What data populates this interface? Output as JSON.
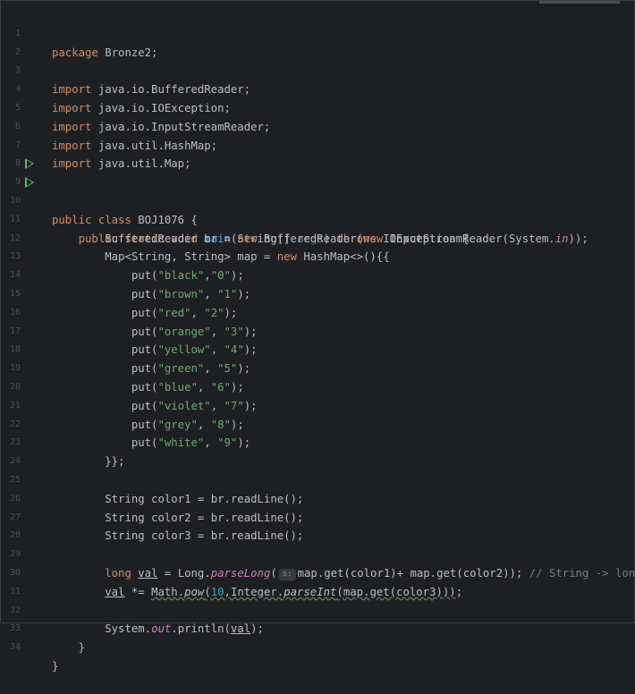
{
  "line_numbers": [
    "1",
    "2",
    "3",
    "4",
    "5",
    "6",
    "7",
    "8",
    "9",
    "10",
    "11",
    "12",
    "13",
    "14",
    "15",
    "16",
    "17",
    "18",
    "19",
    "20",
    "21",
    "22",
    "23",
    "24",
    "25",
    "26",
    "27",
    "28",
    "29",
    "30",
    "31",
    "32",
    "33",
    "34"
  ],
  "code": {
    "l1": {
      "kw": "package",
      "rest": " Bronze2;"
    },
    "l3": {
      "kw": "import",
      "rest": " java.io.BufferedReader;"
    },
    "l4": {
      "kw": "import",
      "rest": " java.io.IOException;"
    },
    "l5": {
      "kw": "import",
      "rest": " java.io.InputStreamReader;"
    },
    "l6": {
      "kw": "import",
      "rest": " java.util.HashMap;"
    },
    "l7": {
      "kw": "import",
      "rest": " java.util.Map;"
    },
    "l9": {
      "kw": "public class",
      "rest": " BOJ1076 {"
    },
    "l10": {
      "indent": "    ",
      "kw": "public static void",
      "sp": " ",
      "fn": "main",
      "a": "(String[] ",
      "param": "args",
      "b": ") ",
      "kw2": "throws",
      "c": " IOException {"
    },
    "l11": {
      "indent": "        ",
      "a": "BufferedReader br = ",
      "kw": "new",
      "b": " BufferedReader(",
      "kw2": "new",
      "c": " InputStreamReader(System.",
      "stat": "in",
      "d": "));"
    },
    "l12": {
      "indent": "        ",
      "a": "Map<String, String> map = ",
      "kw": "new",
      "b": " HashMap<>(){{"
    },
    "puts": [
      {
        "indent": "            ",
        "a": "put(",
        "s1": "\"black\"",
        "c": ",",
        "s2": "\"0\"",
        "e": ");"
      },
      {
        "indent": "            ",
        "a": "put(",
        "s1": "\"brown\"",
        "c": ", ",
        "s2": "\"1\"",
        "e": ");"
      },
      {
        "indent": "            ",
        "a": "put(",
        "s1": "\"red\"",
        "c": ", ",
        "s2": "\"2\"",
        "e": ");"
      },
      {
        "indent": "            ",
        "a": "put(",
        "s1": "\"orange\"",
        "c": ", ",
        "s2": "\"3\"",
        "e": ");"
      },
      {
        "indent": "            ",
        "a": "put(",
        "s1": "\"yellow\"",
        "c": ", ",
        "s2": "\"4\"",
        "e": ");"
      },
      {
        "indent": "            ",
        "a": "put(",
        "s1": "\"green\"",
        "c": ", ",
        "s2": "\"5\"",
        "e": ");"
      },
      {
        "indent": "            ",
        "a": "put(",
        "s1": "\"blue\"",
        "c": ", ",
        "s2": "\"6\"",
        "e": ");"
      },
      {
        "indent": "            ",
        "a": "put(",
        "s1": "\"violet\"",
        "c": ", ",
        "s2": "\"7\"",
        "e": ");"
      },
      {
        "indent": "            ",
        "a": "put(",
        "s1": "\"grey\"",
        "c": ", ",
        "s2": "\"8\"",
        "e": ");"
      },
      {
        "indent": "            ",
        "a": "put(",
        "s1": "\"white\"",
        "c": ", ",
        "s2": "\"9\"",
        "e": ");"
      }
    ],
    "l23": {
      "indent": "        ",
      "a": "}};"
    },
    "l25": {
      "indent": "        ",
      "a": "String color1 = br.readLine();"
    },
    "l26": {
      "indent": "        ",
      "a": "String color2 = br.readLine();"
    },
    "l27": {
      "indent": "        ",
      "a": "String color3 = br.readLine();"
    },
    "l29": {
      "indent": "        ",
      "kw": "long",
      "sp": " ",
      "ul": "val",
      "b": " = Long.",
      "stat": "parseLong",
      "c": "(",
      "hint": "s:",
      "d": "map.get(color1)+ map.get(color2)); ",
      "cm": "// String -> long"
    },
    "l30": {
      "indent": "        ",
      "ul": "val",
      "b": " *= ",
      "w1": "Math.",
      "w1i": "pow",
      "w2": "(",
      "n1": "10",
      "w3": ",Integer.",
      "w3i": "parseInt",
      "w4": "(map.get(color3)))",
      "e": ";"
    },
    "l32": {
      "indent": "        ",
      "a": "System.",
      "stat": "out",
      "b": ".println(",
      "ul": "val",
      "c": ");"
    },
    "l33": {
      "indent": "    ",
      "a": "}"
    },
    "l34": {
      "a": "}"
    }
  },
  "icons": {
    "run": "run-gutter-icon"
  },
  "colors": {
    "background": "#1e1f22",
    "keyword": "#cf8e6d",
    "string": "#6aab73",
    "function": "#56a8f5",
    "number": "#2aacb8",
    "static": "#c77dbb",
    "run": "#5fb865"
  }
}
